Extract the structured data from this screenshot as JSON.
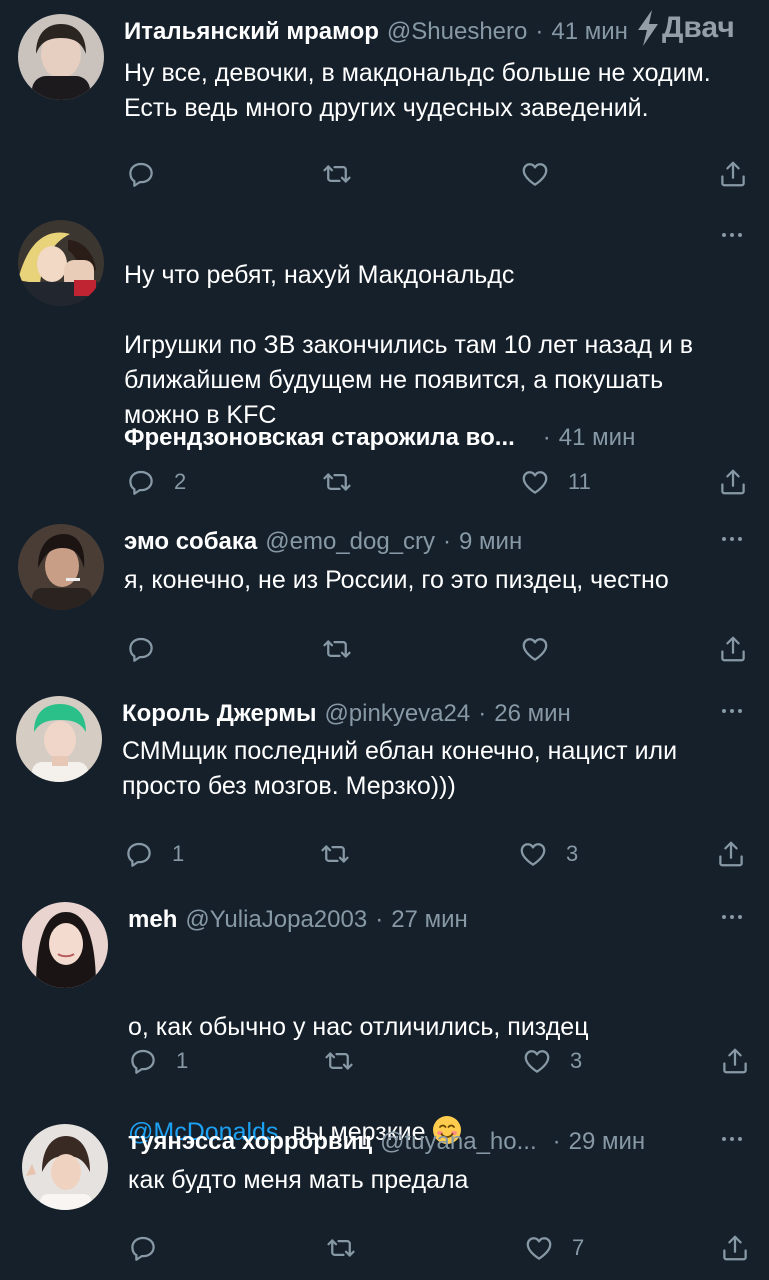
{
  "watermark": "Двач",
  "tweets": [
    {
      "name": "Итальянский мрамор",
      "handle": "@Shueshero",
      "time": "41 мин",
      "text": "Ну все, девочки, в макдональдс больше не ходим.\nЕсть ведь много других чудесных заведений.",
      "replies": "",
      "likes": ""
    },
    {
      "name": "Френдзоновская старожила во...",
      "handle": "",
      "time": "41 мин",
      "text": "Ну что ребят, нахуй Макдональдс\n\nИгрушки по ЗВ закончились там 10 лет назад и в\nближайшем будущем не появится, а покушать\nможно в KFC",
      "replies": "2",
      "likes": "11"
    },
    {
      "name": "эмо собака",
      "handle": "@emo_dog_cry",
      "time": "9 мин",
      "text": "я, конечно, не из России, го это пиздец, честно",
      "replies": "",
      "likes": ""
    },
    {
      "name": "Король Джермы",
      "handle": "@pinkyeva24",
      "time": "26 мин",
      "text": "СММщик последний еблан конечно, нацист или\nпросто без мозгов. Мерзко)))",
      "replies": "1",
      "likes": "3"
    },
    {
      "name": "meh",
      "handle": "@YuliaJopa2003",
      "time": "27 мин",
      "text_line1": "о, как обычно у нас отличились, пиздец",
      "mention": "@McDonalds",
      "text_after_mention": "  вы мерзкие",
      "emoji": "smiling-face-emoji",
      "replies": "1",
      "likes": "3"
    },
    {
      "name": "туянэсса хоррорвиц",
      "handle": "@tuyana_ho...",
      "time": "29 мин",
      "text": "как будто меня мать предала",
      "replies": "",
      "likes": "7"
    }
  ],
  "icons": {
    "reply": "reply-icon",
    "retweet": "retweet-icon",
    "like": "heart-icon",
    "share": "share-icon",
    "more": "more-icon"
  },
  "colors": {
    "background": "#15202b",
    "secondary_text": "#8899a6",
    "link": "#1da1f2"
  }
}
